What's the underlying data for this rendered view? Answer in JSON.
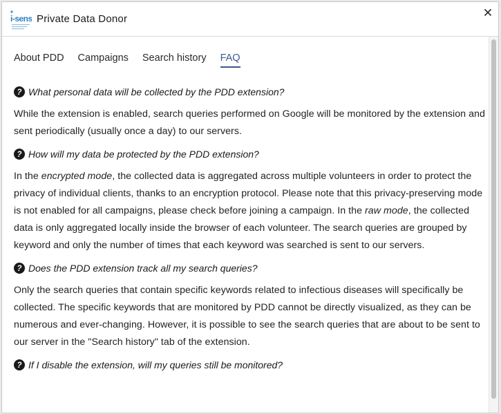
{
  "app": {
    "title": "Private Data Donor",
    "logo_text": "i-sense"
  },
  "tabs": [
    {
      "label": "About PDD",
      "active": false
    },
    {
      "label": "Campaigns",
      "active": false
    },
    {
      "label": "Search history",
      "active": false
    },
    {
      "label": "FAQ",
      "active": true
    }
  ],
  "faq": [
    {
      "question": "What personal data will be collected by the PDD extension?",
      "answer_parts": [
        "While the extension is enabled, search queries performed on Google will be monitored by the extension and sent periodically (usually once a day) to our servers."
      ]
    },
    {
      "question": "How will my data be protected by the PDD extension?",
      "answer_parts": [
        "In the ",
        "encrypted mode",
        ", the collected data is aggregated across multiple volunteers in order to protect the privacy of individual clients, thanks to an encryption protocol. Please note that this privacy-preserving mode is not enabled for all campaigns, please check before joining a campaign. In the ",
        "raw mode",
        ", the collected data is only aggregated locally inside the browser of each volunteer. The search queries are grouped by keyword and only the number of times that each keyword was searched is sent to our servers."
      ]
    },
    {
      "question": "Does the PDD extension track all my search queries?",
      "answer_parts": [
        "Only the search queries that contain specific keywords related to infectious diseases will specifically be collected. The specific keywords that are monitored by PDD cannot be directly visualized, as they can be numerous and ever-changing. However, it is possible to see the search queries that are about to be sent to our server in the \"Search history\" tab of the extension."
      ]
    },
    {
      "question": "If I disable the extension, will my queries still be monitored?",
      "answer_parts": []
    }
  ],
  "colors": {
    "accent": "#3a5a8c",
    "text": "#222222",
    "icon": "#1a1a1a"
  },
  "icons": {
    "question": "question-circle-icon",
    "close": "close-icon",
    "logo": "isense-logo"
  }
}
